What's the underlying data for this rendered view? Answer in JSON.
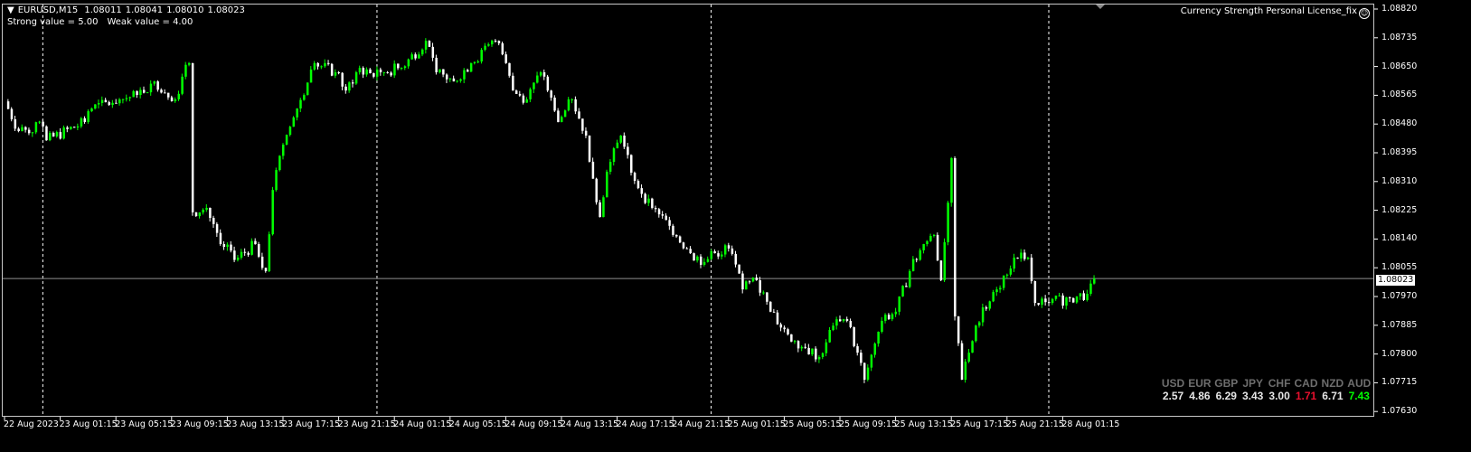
{
  "header": {
    "symbol": "EURUSD,M15",
    "open": "1.08011",
    "high": "1.08041",
    "low": "1.08010",
    "close": "1.08023",
    "strong_value": "Strong value = 5.00",
    "weak_value": "Weak value = 4.00"
  },
  "indicator_title": "Currency Strength Personal License_fix",
  "currency_strength": [
    {
      "name": "USD",
      "value": "2.57",
      "color": "#e6e6e6"
    },
    {
      "name": "EUR",
      "value": "4.86",
      "color": "#e6e6e6"
    },
    {
      "name": "GBP",
      "value": "6.29",
      "color": "#e6e6e6"
    },
    {
      "name": "JPY",
      "value": "3.43",
      "color": "#e6e6e6"
    },
    {
      "name": "CHF",
      "value": "3.00",
      "color": "#e6e6e6"
    },
    {
      "name": "CAD",
      "value": "1.71",
      "color": "#e8102e"
    },
    {
      "name": "NZD",
      "value": "6.71",
      "color": "#e6e6e6"
    },
    {
      "name": "AUD",
      "value": "7.43",
      "color": "#00ff00"
    }
  ],
  "current_price": "1.08023",
  "colors": {
    "bull": "#00ff00",
    "bear": "#ffffff",
    "grid": "#ffffff",
    "price_line": "#909090"
  },
  "chart_data": {
    "type": "candlestick",
    "title": "EURUSD,M15",
    "bars_per_label": 16,
    "ylim": [
      1.076,
      1.0884
    ],
    "yticks": [
      "1.08820",
      "1.08735",
      "1.08650",
      "1.08565",
      "1.08480",
      "1.08395",
      "1.08310",
      "1.08225",
      "1.08140",
      "1.08055",
      "1.07970",
      "1.07885",
      "1.07800",
      "1.07715",
      "1.07630"
    ],
    "xticks": [
      "22 Aug 2023",
      "23 Aug 01:15",
      "23 Aug 05:15",
      "23 Aug 09:15",
      "23 Aug 13:15",
      "23 Aug 17:15",
      "23 Aug 21:15",
      "24 Aug 01:15",
      "24 Aug 05:15",
      "24 Aug 09:15",
      "24 Aug 13:15",
      "24 Aug 17:15",
      "24 Aug 21:15",
      "25 Aug 01:15",
      "25 Aug 05:15",
      "25 Aug 09:15",
      "25 Aug 13:15",
      "25 Aug 17:15",
      "25 Aug 21:15",
      "28 Aug 01:15"
    ],
    "day_separators_bar": [
      11,
      107,
      203,
      300
    ],
    "price_path_bar_close": [
      [
        0,
        1.08547
      ],
      [
        4,
        1.08459
      ],
      [
        11,
        1.08473
      ],
      [
        12,
        1.08432
      ],
      [
        23,
        1.08486
      ],
      [
        25,
        1.08526
      ],
      [
        33,
        1.08553
      ],
      [
        38,
        1.08566
      ],
      [
        43,
        1.08606
      ],
      [
        49,
        1.08553
      ],
      [
        51,
        1.0862
      ],
      [
        53,
        1.0866
      ],
      [
        54,
        1.08219
      ],
      [
        58,
        1.08232
      ],
      [
        62,
        1.08125
      ],
      [
        67,
        1.08085
      ],
      [
        72,
        1.08125
      ],
      [
        75,
        1.08045
      ],
      [
        77,
        1.08285
      ],
      [
        80,
        1.08419
      ],
      [
        84,
        1.08526
      ],
      [
        89,
        1.0866
      ],
      [
        95,
        1.08633
      ],
      [
        98,
        1.08579
      ],
      [
        102,
        1.08646
      ],
      [
        106,
        1.0862
      ],
      [
        108,
        1.08633
      ],
      [
        114,
        1.08646
      ],
      [
        121,
        1.08726
      ],
      [
        124,
        1.08633
      ],
      [
        129,
        1.08606
      ],
      [
        134,
        1.0866
      ],
      [
        141,
        1.08726
      ],
      [
        143,
        1.08686
      ],
      [
        146,
        1.08579
      ],
      [
        150,
        1.08553
      ],
      [
        154,
        1.08633
      ],
      [
        156,
        1.08579
      ],
      [
        159,
        1.08486
      ],
      [
        163,
        1.08553
      ],
      [
        167,
        1.08446
      ],
      [
        171,
        1.08205
      ],
      [
        173,
        1.08339
      ],
      [
        177,
        1.08446
      ],
      [
        181,
        1.08312
      ],
      [
        186,
        1.08232
      ],
      [
        191,
        1.08179
      ],
      [
        197,
        1.08098
      ],
      [
        201,
        1.08072
      ],
      [
        204,
        1.08098
      ],
      [
        208,
        1.08112
      ],
      [
        212,
        1.07991
      ],
      [
        216,
        1.08018
      ],
      [
        220,
        1.07925
      ],
      [
        225,
        1.07858
      ],
      [
        230,
        1.07818
      ],
      [
        234,
        1.07791
      ],
      [
        238,
        1.07884
      ],
      [
        242,
        1.07898
      ],
      [
        245,
        1.07804
      ],
      [
        247,
        1.07724
      ],
      [
        250,
        1.07831
      ],
      [
        252,
        1.07898
      ],
      [
        256,
        1.07925
      ],
      [
        260,
        1.08045
      ],
      [
        264,
        1.08125
      ],
      [
        267,
        1.08152
      ],
      [
        269,
        1.08018
      ],
      [
        272,
        1.08379
      ],
      [
        273,
        1.07911
      ],
      [
        275,
        1.07724
      ],
      [
        277,
        1.07804
      ],
      [
        281,
        1.07938
      ],
      [
        285,
        1.07991
      ],
      [
        290,
        1.08085
      ],
      [
        294,
        1.08085
      ],
      [
        296,
        1.07951
      ],
      [
        300,
        1.07951
      ],
      [
        306,
        1.07965
      ],
      [
        311,
        1.07978
      ],
      [
        313,
        1.08023
      ]
    ]
  }
}
